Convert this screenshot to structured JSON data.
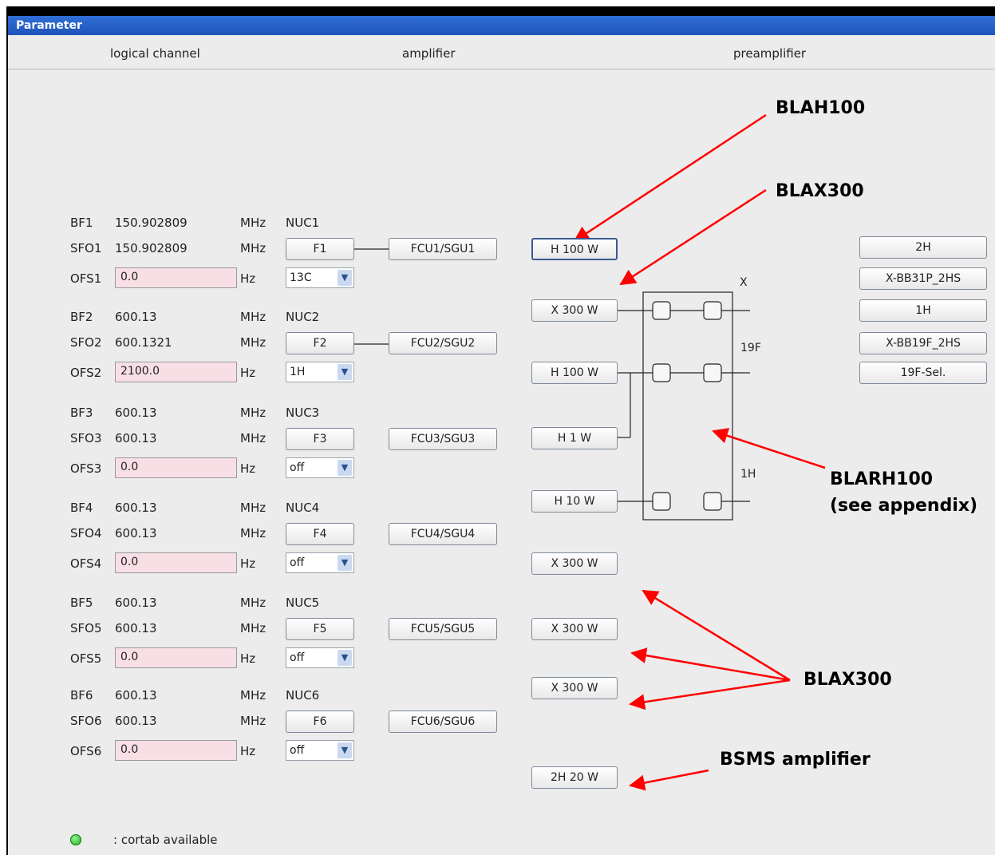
{
  "window": {
    "title": "Parameter"
  },
  "columns": {
    "logical": "logical channel",
    "amplifier": "amplifier",
    "preamp": "preamplifier"
  },
  "channels": [
    {
      "bf_label": "BF1",
      "bf": "150.902809",
      "bf_unit": "MHz",
      "nuc": "NUC1",
      "sfo_label": "SFO1",
      "sfo": "150.902809",
      "sfo_unit": "MHz",
      "f": "F1",
      "fcu": "FCU1/SGU1",
      "ofs_label": "OFS1",
      "ofs": "0.0",
      "ofs_unit": "Hz",
      "nuc_select": "13C"
    },
    {
      "bf_label": "BF2",
      "bf": "600.13",
      "bf_unit": "MHz",
      "nuc": "NUC2",
      "sfo_label": "SFO2",
      "sfo": "600.1321",
      "sfo_unit": "MHz",
      "f": "F2",
      "fcu": "FCU2/SGU2",
      "ofs_label": "OFS2",
      "ofs": "2100.0",
      "ofs_unit": "Hz",
      "nuc_select": "1H"
    },
    {
      "bf_label": "BF3",
      "bf": "600.13",
      "bf_unit": "MHz",
      "nuc": "NUC3",
      "sfo_label": "SFO3",
      "sfo": "600.13",
      "sfo_unit": "MHz",
      "f": "F3",
      "fcu": "FCU3/SGU3",
      "ofs_label": "OFS3",
      "ofs": "0.0",
      "ofs_unit": "Hz",
      "nuc_select": "off"
    },
    {
      "bf_label": "BF4",
      "bf": "600.13",
      "bf_unit": "MHz",
      "nuc": "NUC4",
      "sfo_label": "SFO4",
      "sfo": "600.13",
      "sfo_unit": "MHz",
      "f": "F4",
      "fcu": "FCU4/SGU4",
      "ofs_label": "OFS4",
      "ofs": "0.0",
      "ofs_unit": "Hz",
      "nuc_select": "off"
    },
    {
      "bf_label": "BF5",
      "bf": "600.13",
      "bf_unit": "MHz",
      "nuc": "NUC5",
      "sfo_label": "SFO5",
      "sfo": "600.13",
      "sfo_unit": "MHz",
      "f": "F5",
      "fcu": "FCU5/SGU5",
      "ofs_label": "OFS5",
      "ofs": "0.0",
      "ofs_unit": "Hz",
      "nuc_select": "off"
    },
    {
      "bf_label": "BF6",
      "bf": "600.13",
      "bf_unit": "MHz",
      "nuc": "NUC6",
      "sfo_label": "SFO6",
      "sfo": "600.13",
      "sfo_unit": "MHz",
      "f": "F6",
      "fcu": "FCU6/SGU6",
      "ofs_label": "OFS6",
      "ofs": "0.0",
      "ofs_unit": "Hz",
      "nuc_select": "off"
    }
  ],
  "amplifiers": [
    "H 100 W",
    "X 300 W",
    "H 100 W",
    "H 1 W",
    "H 10 W",
    "X 300 W",
    "X 300 W",
    "X 300 W",
    "2H 20 W"
  ],
  "preamp_box": {
    "x_label": "X",
    "f19_label": "19F",
    "h1_label": "1H"
  },
  "preamp_buttons": [
    "2H",
    "X-BB31P_2HS",
    "1H",
    "X-BB19F_2HS",
    "19F-Sel."
  ],
  "annotations": {
    "blah100": "BLAH100",
    "blax300_top": "BLAX300",
    "blarh100_line1": "BLARH100",
    "blarh100_line2": "(see appendix)",
    "blax300_bottom": "BLAX300",
    "bsms": "BSMS amplifier"
  },
  "legend": {
    "led_color": "#19b019",
    "text": ": cortab available"
  },
  "colors": {
    "title_bar": "#1f54b8",
    "ofs_field": "#f8dfe6",
    "annotation_arrow": "#ff0000",
    "panel": "#ececec"
  }
}
